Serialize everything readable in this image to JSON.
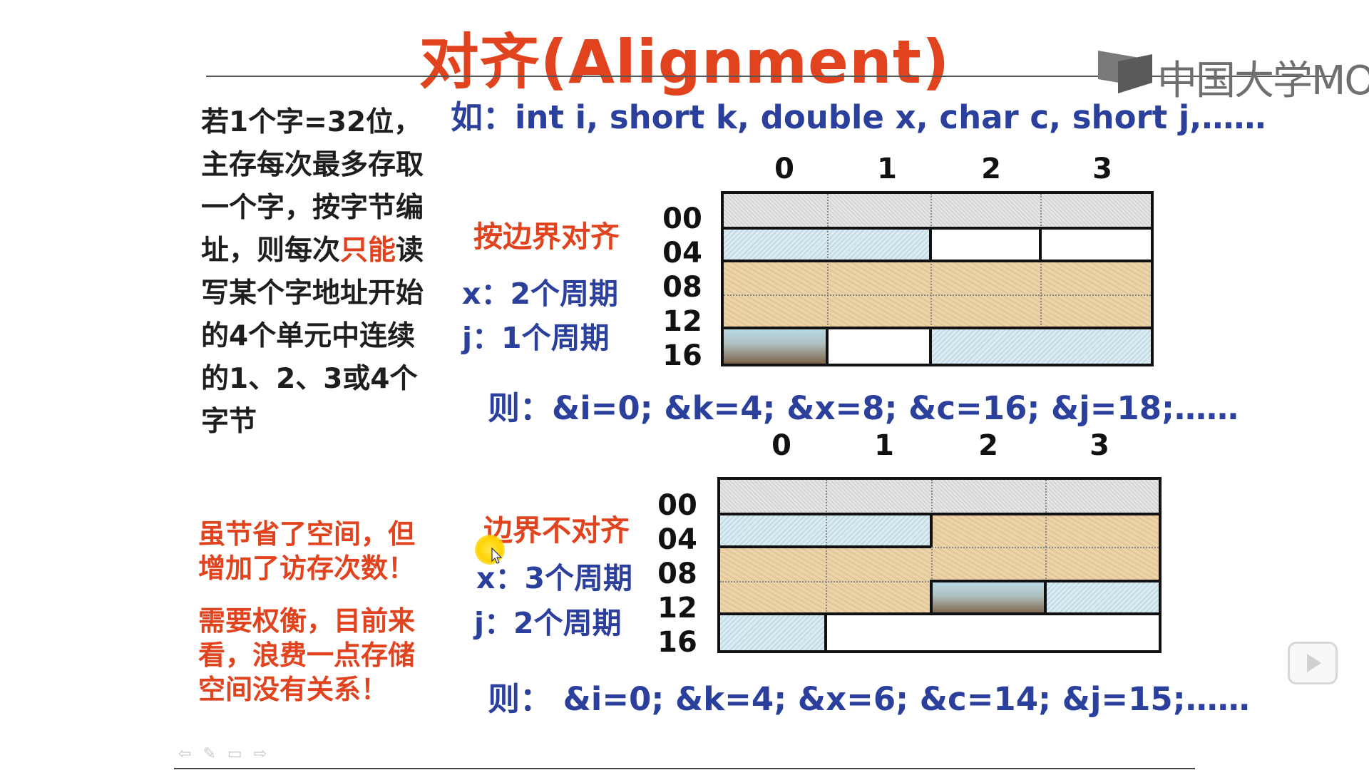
{
  "title": "对齐(Alignment)",
  "logo_text": "中国大学MOOC",
  "example": "如：int i, short k, double x, char c, short j,……",
  "left_desc": {
    "part1": "若1个字=32位，主存每次最多存取一个字，按字节编址，则每次",
    "highlight": "只能",
    "part2": "读写某个字地址开始的4个单元中连续的1、2、3或4个字节"
  },
  "tradeoff1": "虽节省了空间，但增加了访存次数！",
  "tradeoff2": "需要权衡，目前来看，浪费一点存储空间没有关系！",
  "aligned": {
    "heading": "按边界对齐",
    "x_cycles": "x：2个周期",
    "j_cycles": "j：1个周期",
    "columns": [
      "0",
      "1",
      "2",
      "3"
    ],
    "addresses": [
      "00",
      "04",
      "08",
      "12",
      "16"
    ],
    "result": "则：&i=0; &k=4; &x=8; &c=16; &j=18;……"
  },
  "unaligned": {
    "heading": "边界不对齐",
    "x_cycles": "x：3个周期",
    "j_cycles": "j：2个周期",
    "columns": [
      "0",
      "1",
      "2",
      "3"
    ],
    "addresses": [
      "00",
      "04",
      "08",
      "12",
      "16"
    ],
    "result": "则： &i=0; &k=4; &x=6; &c=14; &j=15;……"
  },
  "colors": {
    "title_red": "#e0431e",
    "text_blue": "#2b3f9c",
    "int_gray": "#dcdcdc",
    "short_hatch": "#d8eaf2",
    "double_sand": "#ecd3a8",
    "char_gradient": "#b9dce7"
  },
  "icons": [
    "mooc-logo-icon",
    "cursor-icon",
    "play-icon",
    "back-arrow-icon",
    "pen-icon",
    "menu-icon",
    "forward-arrow-icon"
  ]
}
